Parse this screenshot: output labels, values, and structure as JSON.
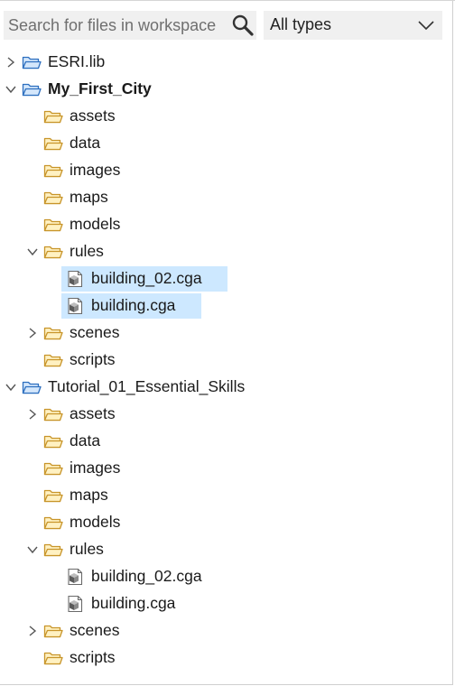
{
  "search": {
    "placeholder": "Search for files in workspace"
  },
  "type_filter": {
    "selected": "All types"
  },
  "tree": [
    {
      "label": "ESRI.lib",
      "depth": 0,
      "kind": "project",
      "chevron": "right",
      "bold": false,
      "selected": false
    },
    {
      "label": "My_First_City",
      "depth": 0,
      "kind": "project",
      "chevron": "down",
      "bold": true,
      "selected": false
    },
    {
      "label": "assets",
      "depth": 1,
      "kind": "folder",
      "chevron": "none",
      "bold": false,
      "selected": false
    },
    {
      "label": "data",
      "depth": 1,
      "kind": "folder",
      "chevron": "none",
      "bold": false,
      "selected": false
    },
    {
      "label": "images",
      "depth": 1,
      "kind": "folder",
      "chevron": "none",
      "bold": false,
      "selected": false
    },
    {
      "label": "maps",
      "depth": 1,
      "kind": "folder",
      "chevron": "none",
      "bold": false,
      "selected": false
    },
    {
      "label": "models",
      "depth": 1,
      "kind": "folder",
      "chevron": "none",
      "bold": false,
      "selected": false
    },
    {
      "label": "rules",
      "depth": 1,
      "kind": "folder",
      "chevron": "down",
      "bold": false,
      "selected": false
    },
    {
      "label": "building_02.cga",
      "depth": 2,
      "kind": "cga",
      "chevron": "none",
      "bold": false,
      "selected": true
    },
    {
      "label": "building.cga",
      "depth": 2,
      "kind": "cga",
      "chevron": "none",
      "bold": false,
      "selected": true
    },
    {
      "label": "scenes",
      "depth": 1,
      "kind": "folder",
      "chevron": "right",
      "bold": false,
      "selected": false
    },
    {
      "label": "scripts",
      "depth": 1,
      "kind": "folder",
      "chevron": "none",
      "bold": false,
      "selected": false
    },
    {
      "label": "Tutorial_01_Essential_Skills",
      "depth": 0,
      "kind": "project",
      "chevron": "down",
      "bold": false,
      "selected": false
    },
    {
      "label": "assets",
      "depth": 1,
      "kind": "folder",
      "chevron": "right",
      "bold": false,
      "selected": false
    },
    {
      "label": "data",
      "depth": 1,
      "kind": "folder",
      "chevron": "none",
      "bold": false,
      "selected": false
    },
    {
      "label": "images",
      "depth": 1,
      "kind": "folder",
      "chevron": "none",
      "bold": false,
      "selected": false
    },
    {
      "label": "maps",
      "depth": 1,
      "kind": "folder",
      "chevron": "none",
      "bold": false,
      "selected": false
    },
    {
      "label": "models",
      "depth": 1,
      "kind": "folder",
      "chevron": "none",
      "bold": false,
      "selected": false
    },
    {
      "label": "rules",
      "depth": 1,
      "kind": "folder",
      "chevron": "down",
      "bold": false,
      "selected": false
    },
    {
      "label": "building_02.cga",
      "depth": 2,
      "kind": "cga",
      "chevron": "none",
      "bold": false,
      "selected": false
    },
    {
      "label": "building.cga",
      "depth": 2,
      "kind": "cga",
      "chevron": "none",
      "bold": false,
      "selected": false
    },
    {
      "label": "scenes",
      "depth": 1,
      "kind": "folder",
      "chevron": "right",
      "bold": false,
      "selected": false
    },
    {
      "label": "scripts",
      "depth": 1,
      "kind": "folder",
      "chevron": "none",
      "bold": false,
      "selected": false
    }
  ],
  "colors": {
    "selection": "#cde8ff",
    "folder_fill": "#fff1c2",
    "folder_stroke": "#c8952a",
    "project_fill": "#d4e7fb",
    "project_stroke": "#2d6fbf"
  },
  "icons": {
    "search": "search-icon",
    "dropdown": "chevron-down-icon",
    "project": "project-folder-icon",
    "folder": "folder-icon",
    "cga": "cga-rule-file-icon"
  }
}
